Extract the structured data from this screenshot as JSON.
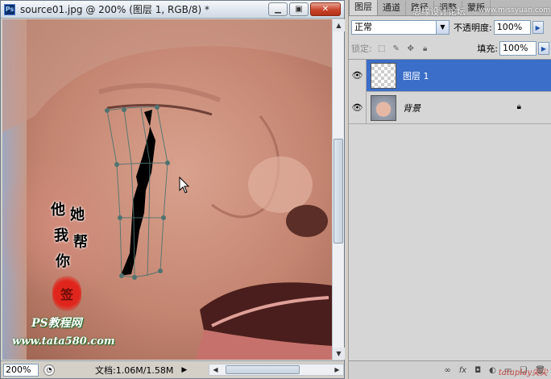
{
  "document": {
    "title": "source01.jpg @ 200% (图层 1, RGB/8) *",
    "app_icon": "Ps",
    "buttons": {
      "minimize": "▁",
      "restore": "▣",
      "close": "✕"
    }
  },
  "canvas_overlay": {
    "calligraphy": [
      "他",
      "她",
      "我",
      "帮",
      "你"
    ],
    "seal": "签",
    "brand": "PS教程网",
    "url": "www.tata580.com"
  },
  "status": {
    "zoom": "200%",
    "doc_size": "文档:1.06M/1.58M"
  },
  "panel": {
    "tabs": [
      "图层",
      "通道",
      "路径",
      "调整",
      "蒙版"
    ],
    "blend_mode": "正常",
    "opacity_label": "不透明度:",
    "opacity": "100%",
    "lock_label": "锁定:",
    "fill_label": "填充:",
    "fill": "100%",
    "layers": [
      {
        "name": "图层 1",
        "selected": true,
        "visible": true
      },
      {
        "name": "背景",
        "selected": false,
        "visible": true,
        "locked": true
      }
    ]
  },
  "watermarks": {
    "top": "思缘设计论坛",
    "url": "www.missyuan.com",
    "bottom": "tataplay尖尖"
  }
}
